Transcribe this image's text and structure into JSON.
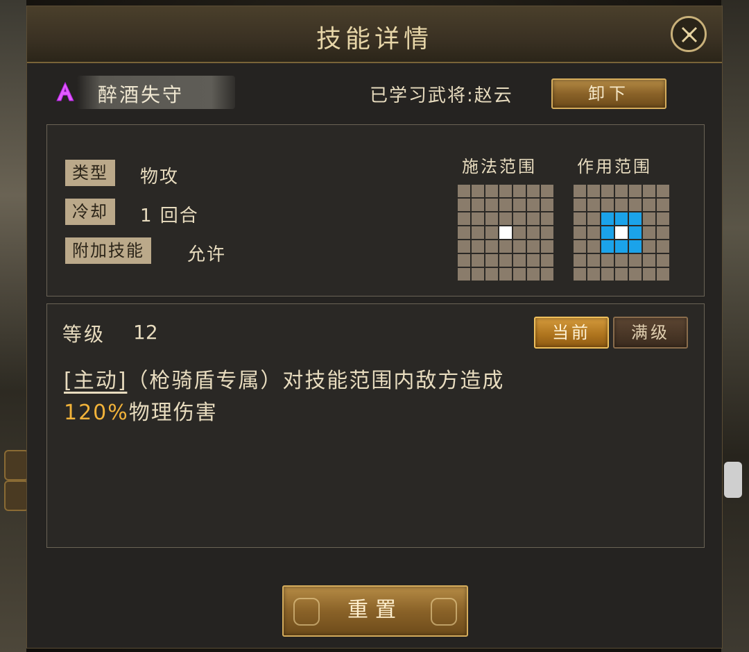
{
  "dialog": {
    "title": "技能详情",
    "close_icon": "close-icon"
  },
  "skill": {
    "icon": "skill-rank-icon",
    "icon_color": "#d94fff",
    "name": "醉酒失守",
    "learned_by": "已学习武将:赵云",
    "unload_label": "卸下"
  },
  "attributes": [
    {
      "tag": "类型",
      "value": "物攻"
    },
    {
      "tag": "冷却",
      "value": "1 回合"
    },
    {
      "tag": "附加技能",
      "value": "允许"
    }
  ],
  "ranges": {
    "cast_label": "施法范围",
    "effect_label": "作用范围",
    "grid_size": 7,
    "cast_center": [
      3,
      3
    ],
    "effect_highlight": [
      [
        2,
        2
      ],
      [
        2,
        3
      ],
      [
        2,
        4
      ],
      [
        3,
        2
      ],
      [
        3,
        4
      ],
      [
        4,
        2
      ],
      [
        4,
        3
      ],
      [
        4,
        4
      ]
    ],
    "highlight_color": "#1ba3ea",
    "center_color": "#ffffff"
  },
  "level": {
    "label": "等级",
    "value": "12",
    "tab_current": "当前",
    "tab_max": "满级"
  },
  "description": {
    "active_tag": "[主动]",
    "text_1": "（枪骑盾专属）对技能范围内敌方造成",
    "highlight": "120%",
    "text_2": "物理伤害"
  },
  "reset_label": "重置"
}
